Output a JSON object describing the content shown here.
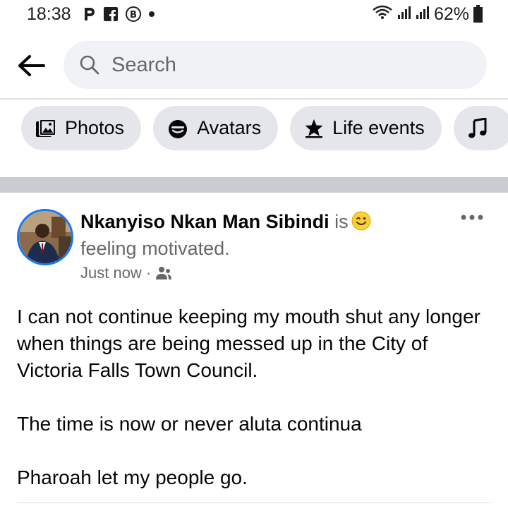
{
  "status_bar": {
    "time": "18:38",
    "notifications": [
      "p-app-icon",
      "facebook-icon",
      "b-app-icon",
      "dot-icon"
    ],
    "battery": "62%"
  },
  "header": {
    "search": {
      "placeholder": "Search"
    }
  },
  "chips": [
    {
      "label": "Photos",
      "icon": "photos-icon"
    },
    {
      "label": "Avatars",
      "icon": "avatar-face-icon"
    },
    {
      "label": "Life events",
      "icon": "star-icon"
    },
    {
      "label": "",
      "icon": "music-note-icon"
    }
  ],
  "post": {
    "author": "Nkanyiso Nkan Man Sibindi",
    "is_text": "is",
    "feeling": "feeling motivated.",
    "time": "Just now",
    "separator": "·",
    "audience_icon": "friends-icon",
    "body": [
      "I can not continue keeping my mouth shut any longer when things are being messed up in the City of Victoria Falls Town Council.",
      "The time is now or never aluta continua",
      "Pharoah let my people go."
    ]
  },
  "colors": {
    "accent": "#1877f2",
    "chip_bg": "#e4e6eb",
    "search_bg": "#f0f2f5",
    "secondary_text": "#65676b",
    "separator": "#c9ccd1"
  }
}
